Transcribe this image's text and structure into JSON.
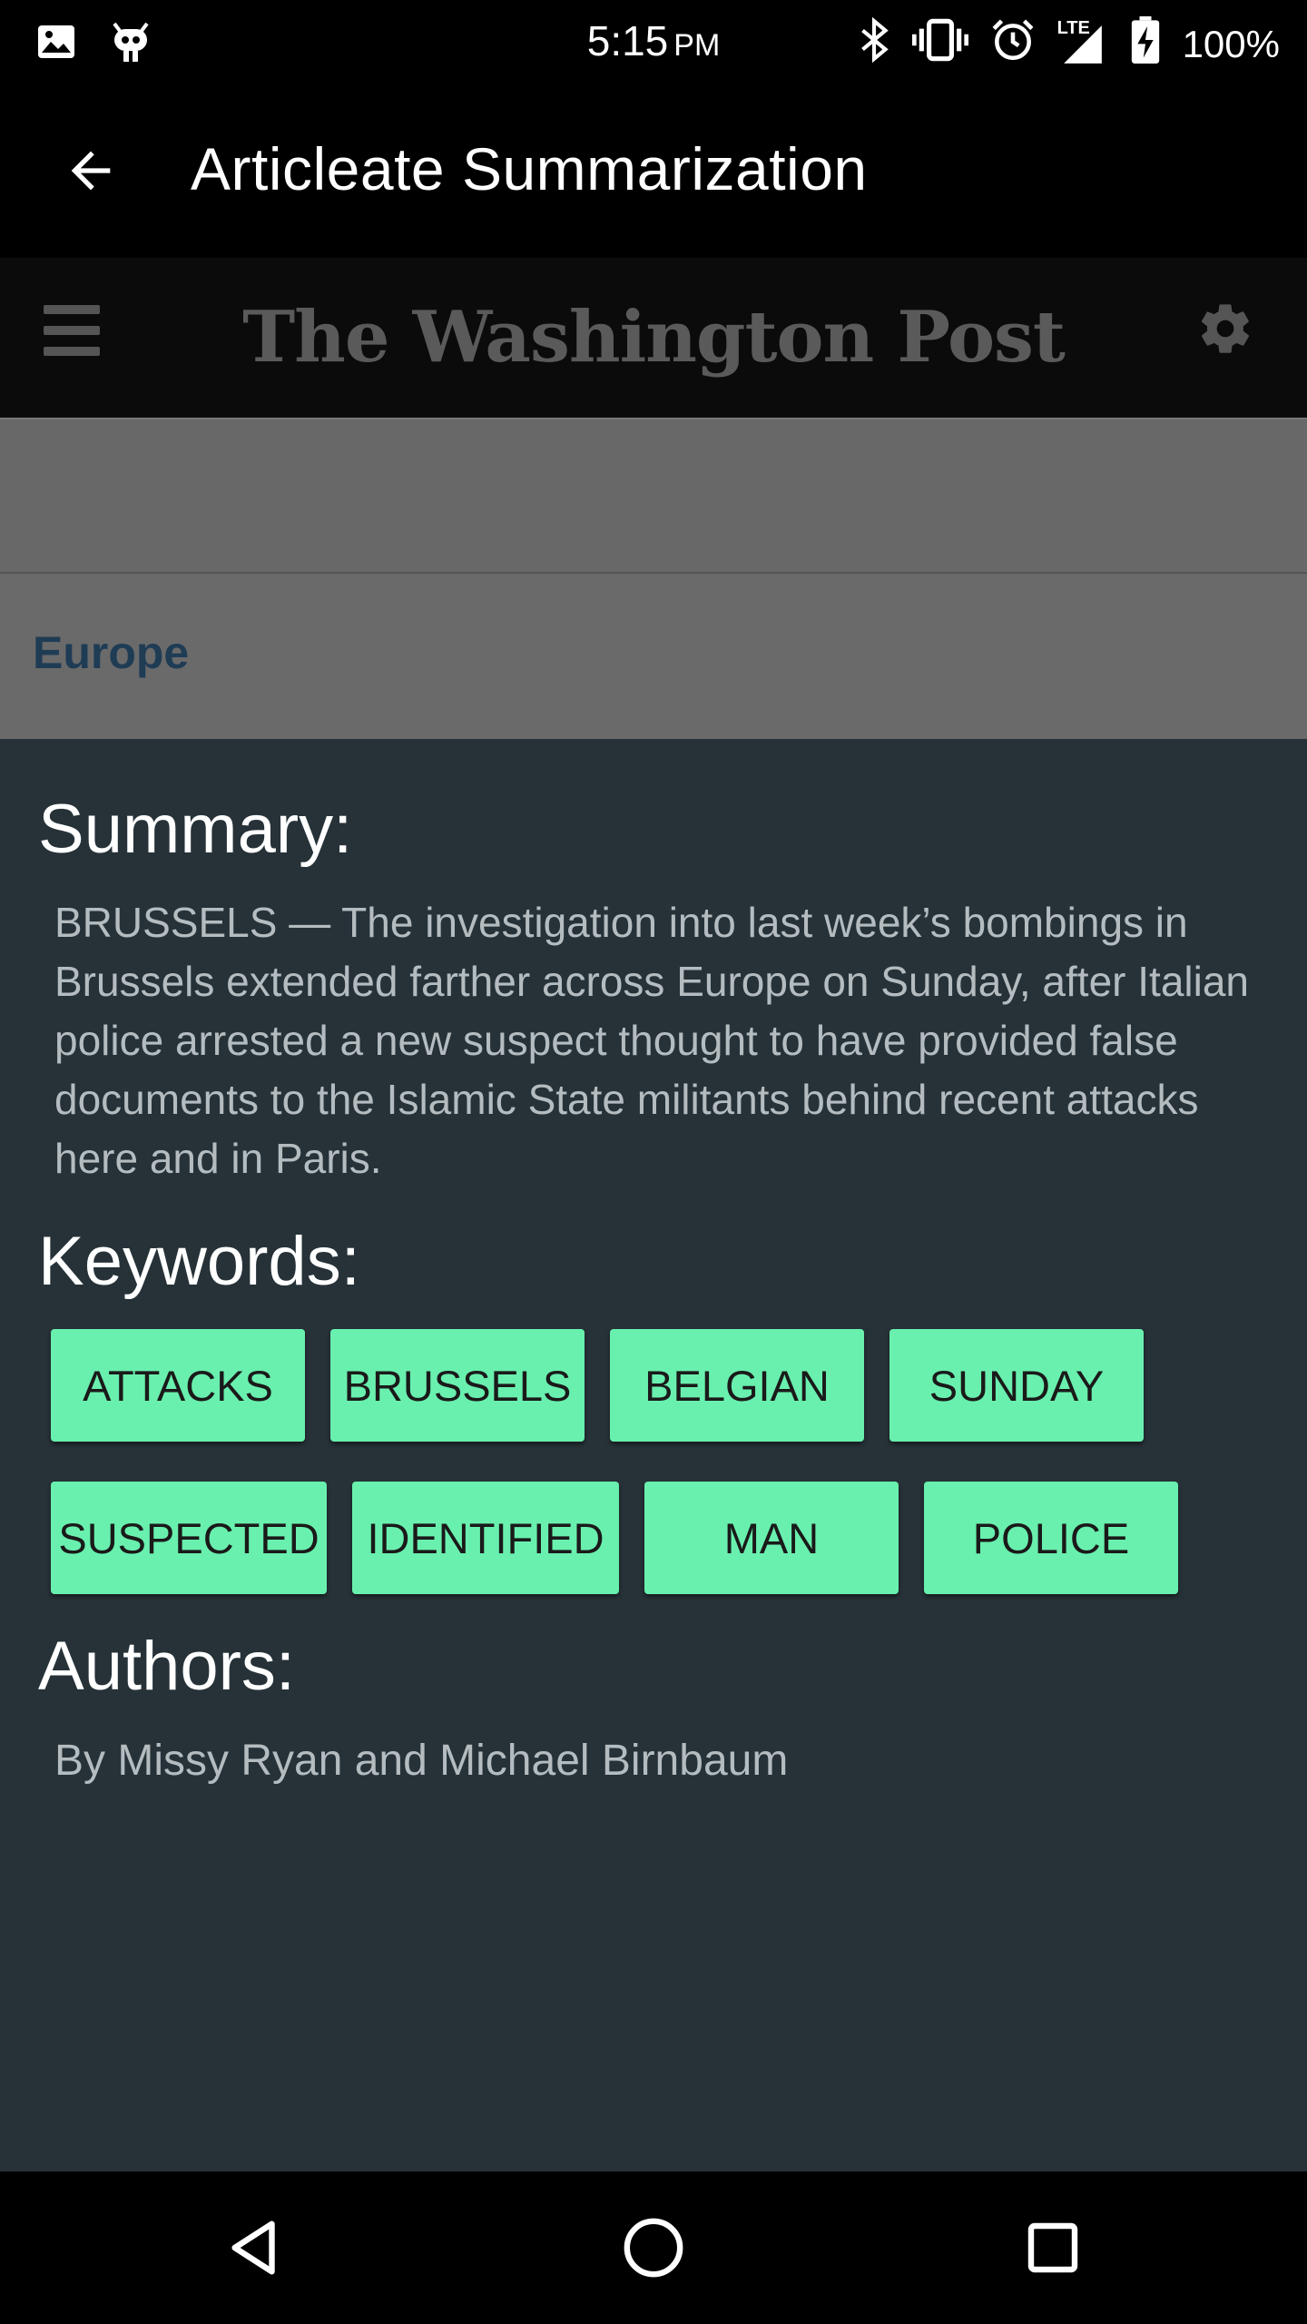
{
  "status_bar": {
    "time": "5:15",
    "ampm": "PM",
    "lte": "LTE",
    "battery": "100%",
    "icons": [
      "image-icon",
      "android-icon",
      "bluetooth-icon",
      "vibrate-icon",
      "alarm-icon",
      "signal-icon",
      "battery-charging-icon"
    ]
  },
  "app_bar": {
    "title": "Articleate Summarization",
    "back_icon": "arrow-back-icon"
  },
  "web": {
    "logo": "The Washington Post",
    "section": "Europe",
    "menu_icon": "hamburger-icon",
    "settings_icon": "gear-icon"
  },
  "sheet": {
    "summary_heading": "Summary:",
    "summary_text": "BRUSSELS — The investigation into last week’s bombings in Brussels extended farther across Europe on Sunday, after Italian police arrested a new suspect thought to have provided false documents to the Islamic State militants behind recent attacks here and in Paris.",
    "keywords_heading": "Keywords:",
    "keywords": [
      "ATTACKS",
      "BRUSSELS",
      "BELGIAN",
      "SUNDAY",
      "SUSPECTED",
      "IDENTIFIED",
      "MAN",
      "POLICE"
    ],
    "authors_heading": "Authors:",
    "authors_text": "By Missy Ryan and Michael Birnbaum"
  },
  "colors": {
    "sheet_bg": "#263238",
    "chip_bg": "#69f0ae",
    "muted_text": "#b4bcc0"
  },
  "nav_bar": {
    "icons": [
      "back-triangle-icon",
      "home-circle-icon",
      "recents-square-icon"
    ]
  }
}
